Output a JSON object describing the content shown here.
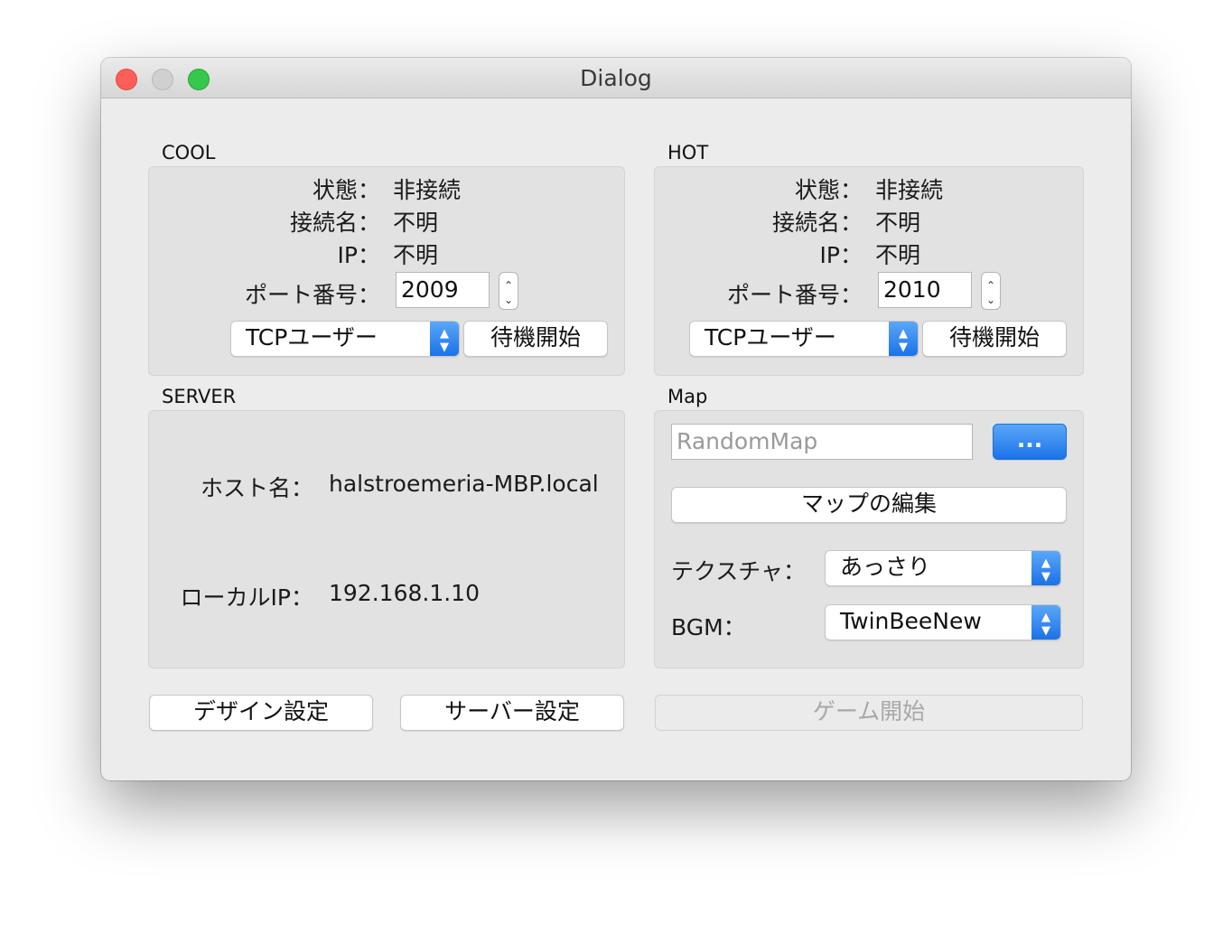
{
  "window": {
    "title": "Dialog"
  },
  "cool": {
    "group_label": "COOL",
    "status_label": "状態：",
    "status_value": "非接続",
    "conn_label": "接続名：",
    "conn_value": "不明",
    "ip_label": "IP：",
    "ip_value": "不明",
    "port_label": "ポート番号：",
    "port_value": "2009",
    "user_type": "TCPユーザー",
    "start_button": "待機開始"
  },
  "hot": {
    "group_label": "HOT",
    "status_label": "状態：",
    "status_value": "非接続",
    "conn_label": "接続名：",
    "conn_value": "不明",
    "ip_label": "IP：",
    "ip_value": "不明",
    "port_label": "ポート番号：",
    "port_value": "2010",
    "user_type": "TCPユーザー",
    "start_button": "待機開始"
  },
  "server": {
    "group_label": "SERVER",
    "host_label": "ホスト名：",
    "host_value": "halstroemeria-MBP.local",
    "local_ip_label": "ローカルIP：",
    "local_ip_value": "192.168.1.10"
  },
  "map": {
    "group_label": "Map",
    "map_placeholder": "RandomMap",
    "browse_button": "...",
    "edit_button": "マップの編集",
    "texture_label": "テクスチャ：",
    "texture_value": "あっさり",
    "bgm_label": "BGM：",
    "bgm_value": "TwinBeeNew"
  },
  "footer": {
    "design_button": "デザイン設定",
    "server_button": "サーバー設定",
    "start_game_button": "ゲーム開始"
  },
  "colors": {
    "accent": "#1b72e8",
    "close": "#fc5f57",
    "zoom": "#35c84a"
  }
}
